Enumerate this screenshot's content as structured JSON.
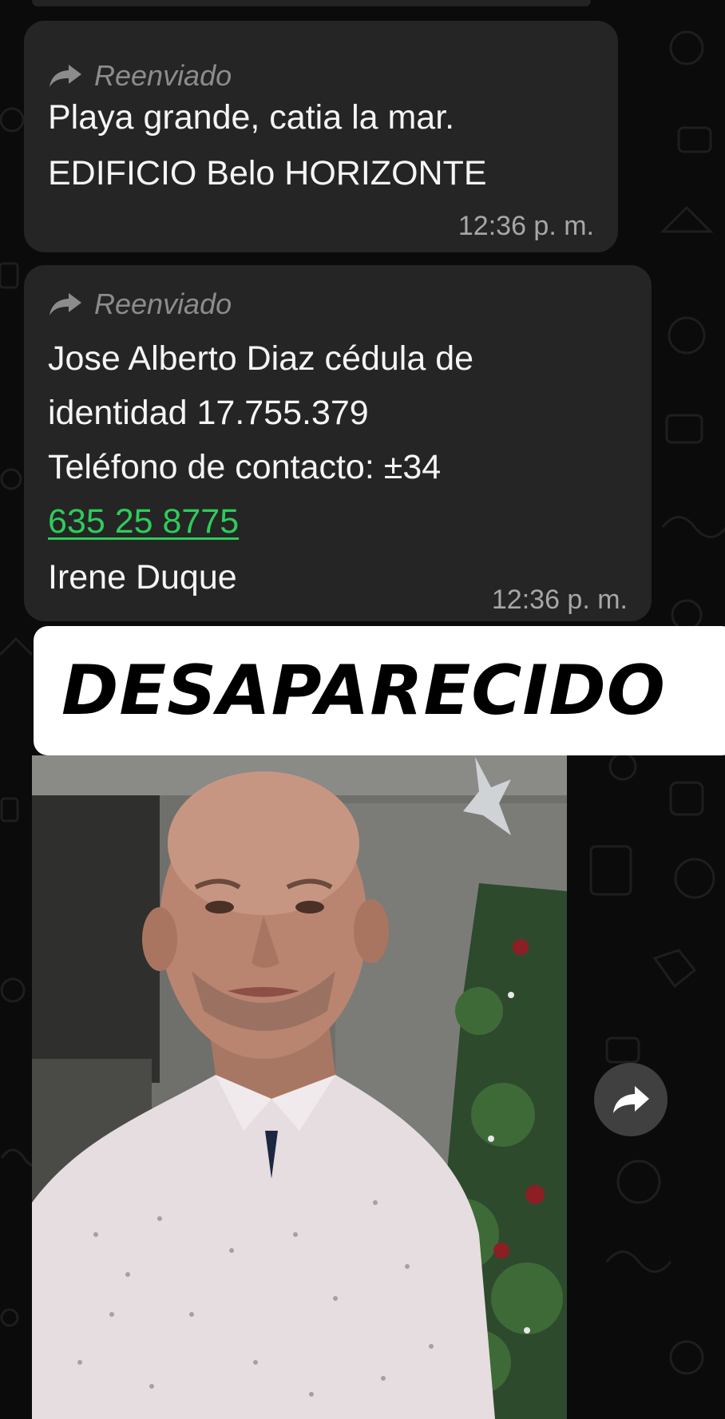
{
  "messages": [
    {
      "forwarded_label": "Reenviado",
      "lines": [
        "Playa grande, catia la mar.",
        "EDIFICIO Belo HORIZONTE"
      ],
      "time": "12:36 p. m."
    },
    {
      "forwarded_label": "Reenviado",
      "lines": [
        "Jose Alberto Diaz cédula de",
        "identidad 17.755.379",
        "Teléfono de contacto: ±34"
      ],
      "phone_link": "635 25 8775",
      "last_line": "Irene Duque",
      "time": "12:36 p. m."
    }
  ],
  "banner": {
    "text": "DESAPARECIDO"
  },
  "photo": {
    "icon": "forward-share-icon"
  },
  "colors": {
    "background": "#0b0b0b",
    "bubble": "#252525",
    "link": "#2ecc5a"
  }
}
